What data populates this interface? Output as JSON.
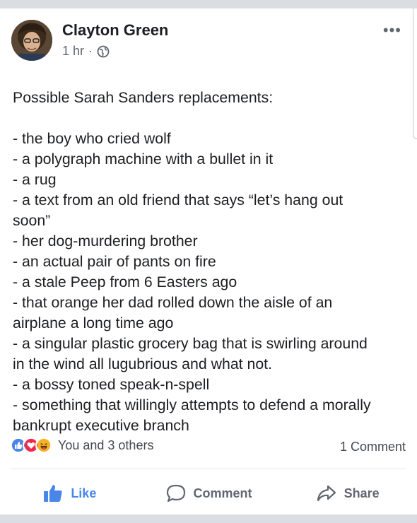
{
  "post": {
    "author": "Clayton Green",
    "time": "1 hr",
    "separator": "·",
    "more_label": "•••",
    "lines": [
      "Possible Sarah Sanders replacements:",
      "",
      "- the boy who cried wolf",
      "- a polygraph machine with a bullet in it",
      "- a rug",
      "- a text from an old friend that says “let’s hang out",
      "soon”",
      "- her dog-murdering brother",
      "- an actual pair of pants on fire",
      "- a stale Peep from 6 Easters ago",
      "- that orange her dad rolled down the aisle of an",
      "airplane a long time ago",
      "- a singular plastic grocery bag that is  swirling around",
      "in the wind all lugubrious and what not.",
      "- a bossy toned speak-n-spell",
      "- something that willingly attempts to defend a morally",
      "bankrupt executive branch"
    ]
  },
  "reactions": {
    "icons": [
      "like-reaction-icon",
      "love-reaction-icon",
      "haha-reaction-icon"
    ],
    "text": "You and 3 others",
    "comments": "1 Comment"
  },
  "actions": {
    "like": "Like",
    "comment": "Comment",
    "share": "Share"
  },
  "colors": {
    "like_blue": "#4a86e8",
    "love_red": "#f0284a",
    "haha_yellow": "#f7b125",
    "muted": "#606770"
  }
}
